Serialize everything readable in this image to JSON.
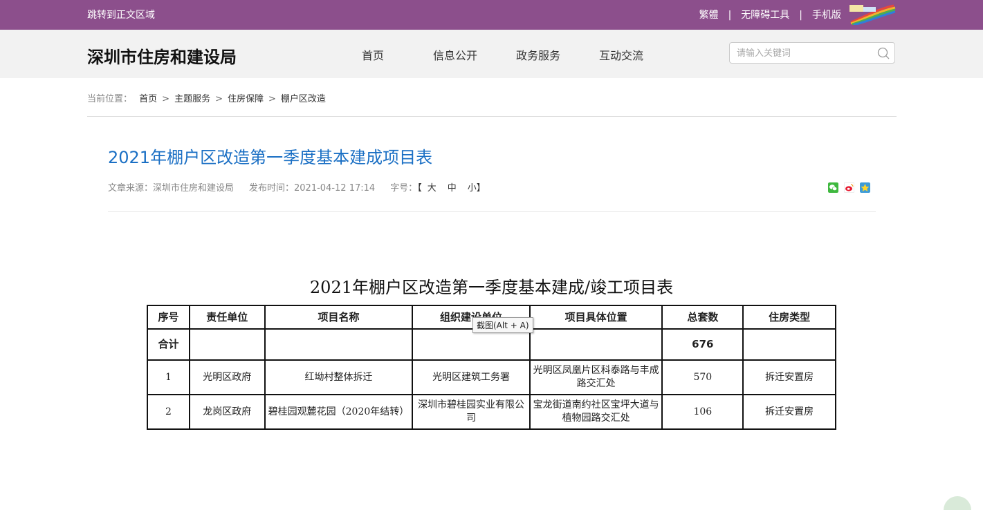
{
  "topbar": {
    "skip_link": "跳转到正文区域",
    "traditional": "繁體",
    "accessibility": "无障碍工具",
    "mobile": "手机版",
    "separator": "|",
    "bg_color": "#8c4f8c"
  },
  "header": {
    "site_title": "深圳市住房和建设局",
    "nav": [
      "首页",
      "信息公开",
      "政务服务",
      "互动交流"
    ],
    "search_placeholder": "请输入关键词"
  },
  "breadcrumb": {
    "label": "当前位置：",
    "items": [
      "首页",
      "主题服务",
      "住房保障",
      "棚户区改造"
    ],
    "separator": ">"
  },
  "article": {
    "title": "2021年棚户区改造第一季度基本建成项目表",
    "source": "文章来源：深圳市住房和建设局",
    "published": "发布时间：2021-04-12 17:14",
    "font_size_label": "字号：",
    "font_size_open": "【",
    "font_sizes": [
      "大",
      "中",
      "小"
    ],
    "font_size_close": "】",
    "title_color": "#1a6fc4",
    "share_icons": [
      "wechat-icon",
      "weibo-icon",
      "qzone-icon"
    ]
  },
  "table": {
    "title": "2021年棚户区改造第一季度基本建成/竣工项目表",
    "headers": [
      "序号",
      "责任单位",
      "项目名称",
      "组织建设单位",
      "项目具体位置",
      "总套数",
      "住房类型"
    ],
    "total_row": [
      "合计",
      "",
      "",
      "",
      "",
      "676",
      ""
    ],
    "rows": [
      [
        "1",
        "光明区政府",
        "红坳村整体拆迁",
        "光明区建筑工务署",
        "光明区凤凰片区科泰路与丰成路交汇处",
        "570",
        "拆迁安置房"
      ],
      [
        "2",
        "龙岗区政府",
        "碧桂园观麓花园（2020年结转）",
        "深圳市碧桂园实业有限公司",
        "宝龙街道南约社区宝坪大道与植物园路交汇处",
        "106",
        "拆迁安置房"
      ]
    ]
  },
  "tooltip": "截图(Alt + A)"
}
